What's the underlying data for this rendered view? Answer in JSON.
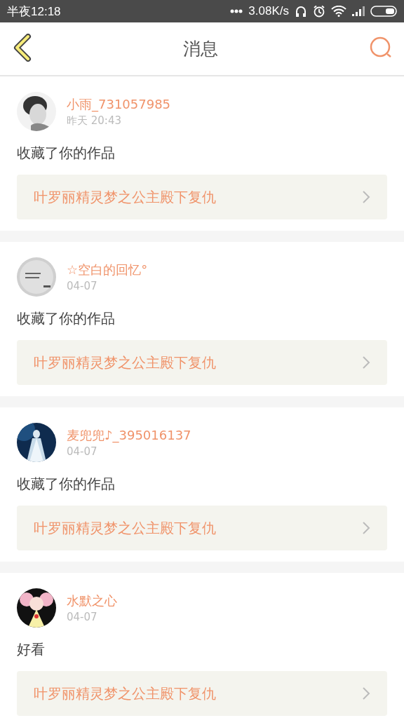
{
  "status_bar": {
    "time": "半夜12:18",
    "speed": "3.08K/s"
  },
  "header": {
    "title": "消息"
  },
  "messages": [
    {
      "name": "小雨_731057985",
      "time": "昨天 20:43",
      "action": "收藏了你的作品",
      "work": "叶罗丽精灵梦之公主殿下复仇"
    },
    {
      "name": "☆空白的回忆°",
      "time": "04-07",
      "action": "收藏了你的作品",
      "work": "叶罗丽精灵梦之公主殿下复仇"
    },
    {
      "name": "麦兜兜♪_395016137",
      "time": "04-07",
      "action": "收藏了你的作品",
      "work": "叶罗丽精灵梦之公主殿下复仇"
    },
    {
      "name": "水默之心",
      "time": "04-07",
      "action": "好看",
      "work": "叶罗丽精灵梦之公主殿下复仇"
    }
  ]
}
